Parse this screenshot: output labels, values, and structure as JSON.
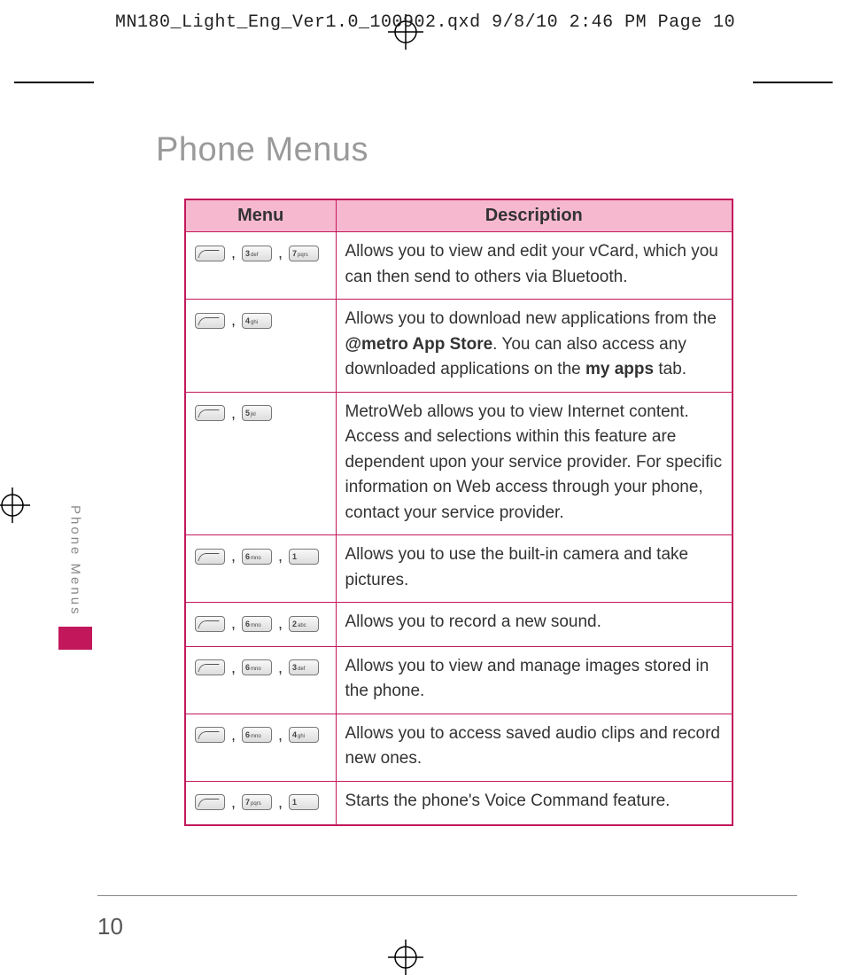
{
  "slug": "MN180_Light_Eng_Ver1.0_100902.qxd  9/8/10  2:46 PM  Page 10",
  "title": "Phone Menus",
  "side_label": "Phone Menus",
  "page_number": "10",
  "table": {
    "headers": {
      "menu": "Menu",
      "desc": "Description"
    },
    "rows": [
      {
        "keys": [
          "soft",
          "3def",
          "7pqrs"
        ],
        "desc_pre": "Allows you to view and edit your vCard, which you can then send to others via Bluetooth.",
        "desc_bold1": "",
        "desc_mid": "",
        "desc_bold2": "",
        "desc_post": ""
      },
      {
        "keys": [
          "soft",
          "4ghi"
        ],
        "desc_pre": "Allows you to download new applications from the ",
        "desc_bold1": "@metro App Store",
        "desc_mid": ". You can also access any downloaded applications on the ",
        "desc_bold2": "my apps",
        "desc_post": " tab."
      },
      {
        "keys": [
          "soft",
          "5jkl"
        ],
        "desc_pre": "MetroWeb allows you to view Internet content. Access and selections within this feature are dependent upon your service provider. For specific information on Web access through your phone, contact your service provider.",
        "desc_bold1": "",
        "desc_mid": "",
        "desc_bold2": "",
        "desc_post": ""
      },
      {
        "keys": [
          "soft",
          "6mno",
          "1"
        ],
        "desc_pre": "Allows you to use the built-in camera and take pictures.",
        "desc_bold1": "",
        "desc_mid": "",
        "desc_bold2": "",
        "desc_post": ""
      },
      {
        "keys": [
          "soft",
          "6mno",
          "2abc"
        ],
        "desc_pre": "Allows you to record a new sound.",
        "desc_bold1": "",
        "desc_mid": "",
        "desc_bold2": "",
        "desc_post": ""
      },
      {
        "keys": [
          "soft",
          "6mno",
          "3def"
        ],
        "desc_pre": "Allows you to view and manage images stored in the phone.",
        "desc_bold1": "",
        "desc_mid": "",
        "desc_bold2": "",
        "desc_post": ""
      },
      {
        "keys": [
          "soft",
          "6mno",
          "4ghi"
        ],
        "desc_pre": "Allows you to access saved audio clips and record new ones.",
        "desc_bold1": "",
        "desc_mid": "",
        "desc_bold2": "",
        "desc_post": ""
      },
      {
        "keys": [
          "soft",
          "7pqrs",
          "1"
        ],
        "desc_pre": "Starts the phone's Voice Command feature.",
        "desc_bold1": "",
        "desc_mid": "",
        "desc_bold2": "",
        "desc_post": ""
      }
    ]
  },
  "key_labels": {
    "soft": "",
    "1": "1",
    "2abc": "2 abc",
    "3def": "3 def",
    "4ghi": "4 ghi",
    "5jkl": "5 jkl",
    "6mno": "6 mno",
    "7pqrs": "7 pqrs"
  }
}
